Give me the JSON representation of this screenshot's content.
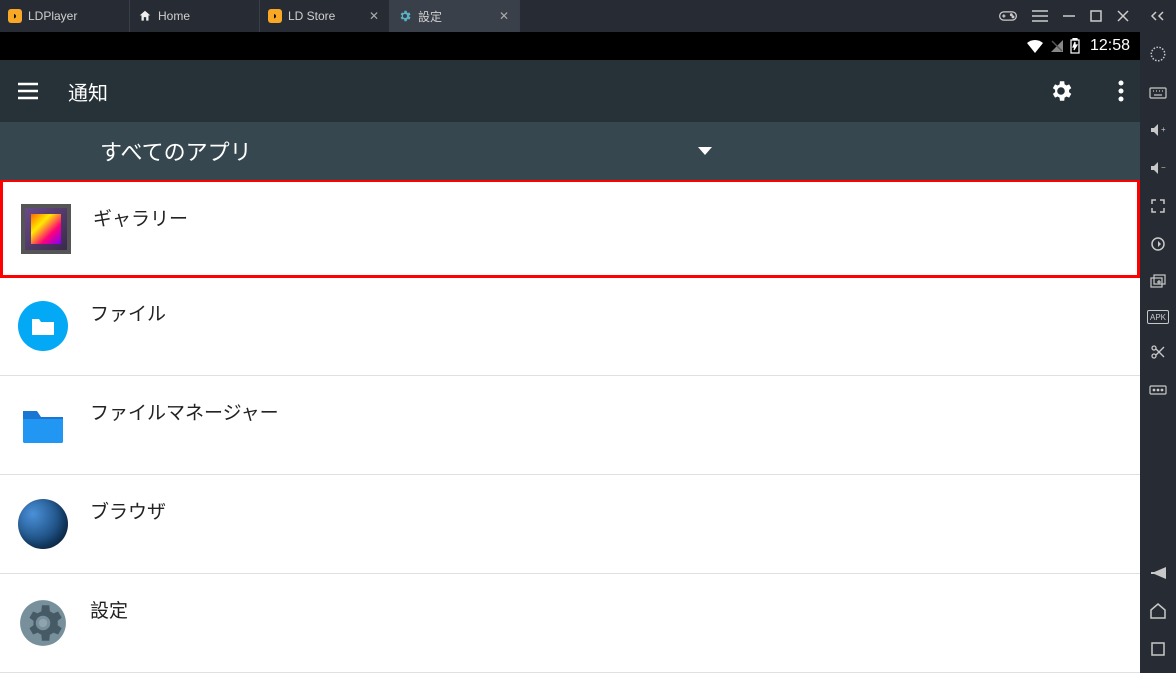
{
  "tabs": [
    {
      "label": "LDPlayer",
      "icon": "ld",
      "closable": false
    },
    {
      "label": "Home",
      "icon": "home",
      "closable": false
    },
    {
      "label": "LD Store",
      "icon": "ld",
      "closable": true
    },
    {
      "label": "設定",
      "icon": "gear",
      "closable": true,
      "active": true
    }
  ],
  "status": {
    "time": "12:58"
  },
  "appbar": {
    "title": "通知"
  },
  "dropdown": {
    "label": "すべてのアプリ"
  },
  "apps": [
    {
      "label": "ギャラリー",
      "icon": "gallery",
      "highlighted": true
    },
    {
      "label": "ファイル",
      "icon": "files"
    },
    {
      "label": "ファイルマネージャー",
      "icon": "folder"
    },
    {
      "label": "ブラウザ",
      "icon": "globe"
    },
    {
      "label": "設定",
      "icon": "settings"
    }
  ]
}
